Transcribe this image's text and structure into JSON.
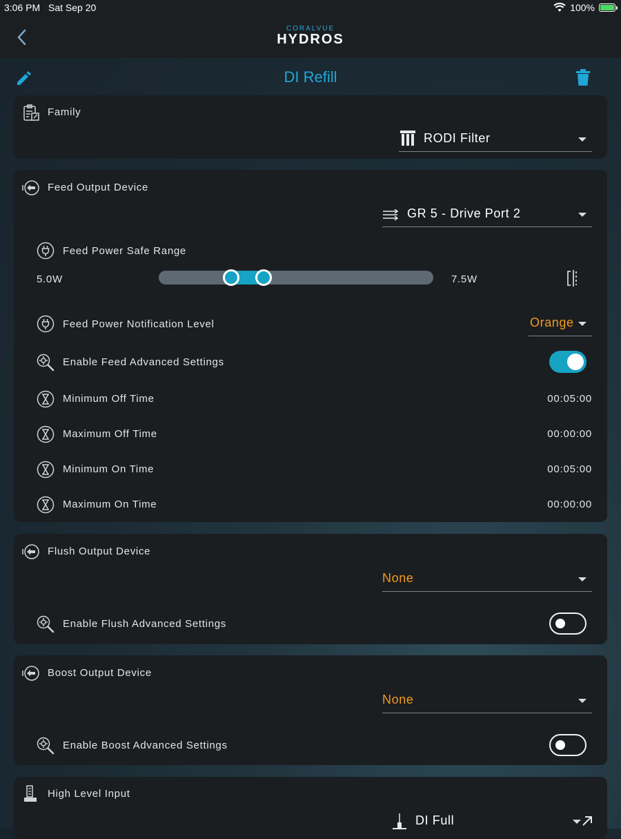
{
  "status_bar": {
    "time": "3:06 PM",
    "date": "Sat Sep 20",
    "battery": "100%"
  },
  "header": {
    "brand_small": "CORALVUE",
    "brand_big": "HYDROS",
    "title": "DI Refill"
  },
  "family": {
    "label": "Family",
    "value": "RODI Filter"
  },
  "feed": {
    "label": "Feed Output Device",
    "device": "GR 5 - Drive Port 2",
    "safe_range_label": "Feed Power Safe Range",
    "range_min": "5.0W",
    "range_max": "7.5W",
    "notification_label": "Feed Power Notification Level",
    "notification_value": "Orange",
    "advanced_label": "Enable Feed Advanced Settings",
    "advanced_enabled": true,
    "min_off_label": "Minimum Off Time",
    "min_off_value": "00:05:00",
    "max_off_label": "Maximum Off Time",
    "max_off_value": "00:00:00",
    "min_on_label": "Minimum On Time",
    "min_on_value": "00:05:00",
    "max_on_label": "Maximum On Time",
    "max_on_value": "00:00:00"
  },
  "flush": {
    "label": "Flush Output Device",
    "device": "None",
    "advanced_label": "Enable Flush Advanced Settings",
    "advanced_enabled": false
  },
  "boost": {
    "label": "Boost Output Device",
    "device": "None",
    "advanced_label": "Enable Boost Advanced Settings",
    "advanced_enabled": false
  },
  "high_level": {
    "label": "High Level Input",
    "value": "DI Full"
  },
  "colors": {
    "accent": "#1ea7d8",
    "toggle_on": "#17a3c4",
    "warning": "#f39a1c",
    "card": "#1b1e21"
  },
  "icons": [
    "back-icon",
    "edit-icon",
    "trash-icon",
    "clipboard-icon",
    "output-device-icon",
    "filter-icon",
    "flow-arrows-icon",
    "plug-icon",
    "range-adjust-icon",
    "gear-search-icon",
    "hourglass-icon",
    "level-sensor-icon",
    "external-link-icon",
    "wifi-icon",
    "battery-icon"
  ]
}
